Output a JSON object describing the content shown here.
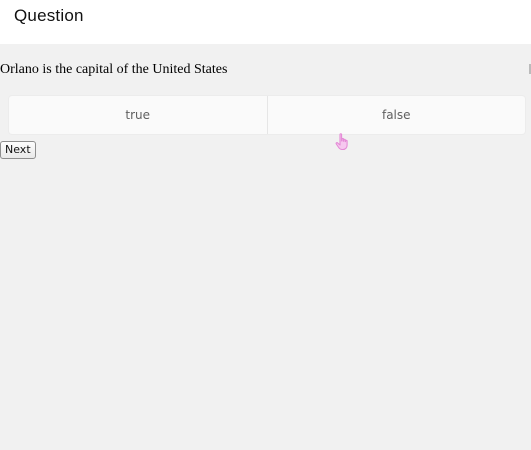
{
  "header": {
    "title": "Question"
  },
  "question": {
    "text": "Orlano is the capital of the United States"
  },
  "options": [
    {
      "label": "true"
    },
    {
      "label": "false"
    }
  ],
  "actions": {
    "next_label": "Next"
  },
  "cursor": {
    "icon": "hand-pointer-icon",
    "color": "#e48ad6"
  }
}
